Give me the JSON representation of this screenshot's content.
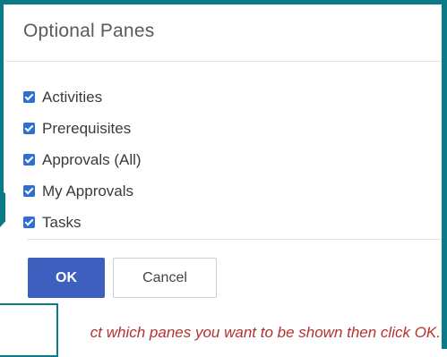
{
  "dialog": {
    "title": "Optional Panes",
    "options": [
      {
        "label": "Activities",
        "checked": true
      },
      {
        "label": "Prerequisites",
        "checked": true
      },
      {
        "label": "Approvals (All)",
        "checked": true
      },
      {
        "label": "My Approvals",
        "checked": true
      },
      {
        "label": "Tasks",
        "checked": true
      }
    ],
    "ok_label": "OK",
    "cancel_label": "Cancel",
    "instruction": "ct which panes you want to be shown then click OK."
  },
  "colors": {
    "frame": "#0b7a87",
    "checkbox": "#2f6fd0",
    "ok_button": "#3f5fbf",
    "instruction_text": "#b3312e"
  }
}
